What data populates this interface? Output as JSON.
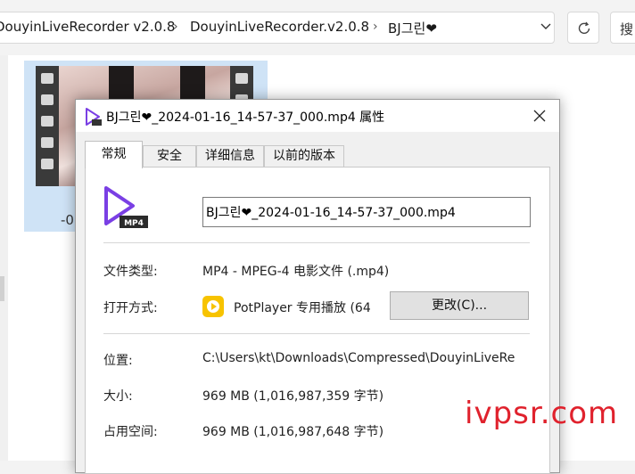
{
  "explorer": {
    "breadcrumbs": [
      "DouyinLiveRecorder v2.0.8",
      "DouyinLiveRecorder.v2.0.8",
      "BJ그린❤"
    ],
    "search_placeholder": "搜",
    "file_tile_label": "-0"
  },
  "dialog": {
    "title": "BJ그린❤_2024-01-16_14-57-37_000.mp4 属性",
    "tabs": [
      {
        "label": "常规",
        "active": true
      },
      {
        "label": "安全",
        "active": false
      },
      {
        "label": "详细信息",
        "active": false
      },
      {
        "label": "以前的版本",
        "active": false
      }
    ],
    "filename": "BJ그린❤_2024-01-16_14-57-37_000.mp4",
    "file_type_label": "文件类型:",
    "file_type_value": "MP4 - MPEG-4 电影文件 (.mp4)",
    "opens_with_label": "打开方式:",
    "opens_with_value": "PotPlayer 专用播放 (64",
    "change_button": "更改(C)...",
    "location_label": "位置:",
    "location_value": "C:\\Users\\kt\\Downloads\\Compressed\\DouyinLiveRe",
    "size_label": "大小:",
    "size_value": "969 MB (1,016,987,359 字节)",
    "size_on_disk_label": "占用空间:",
    "size_on_disk_value": "969 MB (1,016,987,648 字节)"
  },
  "watermark": "ivpsr.com",
  "colors": {
    "mp4_icon_accent": "#7a3fe4",
    "potplayer_yellow": "#f7c300",
    "watermark_red": "#e0222d"
  }
}
